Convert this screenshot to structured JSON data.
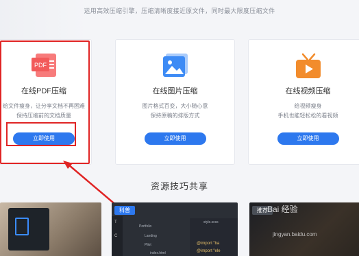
{
  "header": {
    "tagline": "运用高效压缩引擎，压缩清晰度接近原文件，同时最大限度压缩文件"
  },
  "cards": {
    "pdf": {
      "icon": "pdf-file-icon",
      "icon_label": "PDF",
      "title": "在线PDF压缩",
      "desc_line1": "给文件瘦身，让分享文档不再困难",
      "desc_line2": "保持压缩前的文档质量",
      "button": "立即使用"
    },
    "image": {
      "icon": "picture-icon",
      "title": "在线图片压缩",
      "desc_line1": "图片格式百变，大小随心意",
      "desc_line2": "保持原稿的排版方式",
      "button": "立即使用"
    },
    "video": {
      "icon": "tv-play-icon",
      "title": "在线视频压缩",
      "desc_line1": "给视频瘦身",
      "desc_line2": "手机也能轻松松的看视频",
      "button": "立即使用"
    }
  },
  "resources": {
    "title": "资源技巧共享",
    "thumbs": [
      {
        "tag": ""
      },
      {
        "tag": "科普",
        "tree": [
          "Portfolio",
          "Landing",
          "Pilot",
          "index.html"
        ],
        "sidebar": [
          "T",
          "C"
        ],
        "code": [
          "@import \"ba",
          "@import \"ele"
        ],
        "editor_tab": "style.scss"
      },
      {
        "tag": "推荐"
      }
    ]
  },
  "watermark": {
    "text": "Bai 经验",
    "sub": "jingyan.baidu.com"
  },
  "colors": {
    "accent": "#2d78ee",
    "highlight": "#e02424",
    "pdf_icon": "#f25a5a",
    "image_icon": "#3d8bf5",
    "video_icon": "#f28c2c"
  }
}
